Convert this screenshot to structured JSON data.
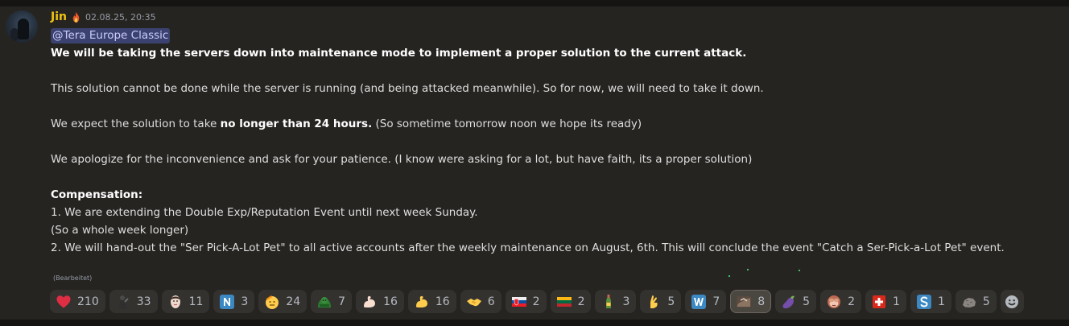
{
  "message": {
    "author": "Jin",
    "timestamp": "02.08.25, 20:35",
    "mention": "@Tera Europe Classic",
    "headline": "We will be taking the servers down into maintenance mode to implement a proper solution to the current attack.",
    "paragraph1": "This solution cannot be done while the server is running (and being attacked meanwhile). So for now, we will need to take it down.",
    "paragraph2": {
      "before": "We expect the solution to take ",
      "bold": "no longer than 24 hours.",
      "after": " (So sometime tomorrow noon we hope its ready)"
    },
    "paragraph3": "We apologize for the inconvenience and ask for your patience. (I know were asking for a lot, but have faith, its a proper solution)",
    "compensation_heading": "Compensation:",
    "compensation_lines": [
      "1. We are extending the Double Exp/Reputation Event until next week Sunday.",
      "(So a whole week longer)",
      "2. We will hand-out the \"Ser Pick-A-Lot Pet\" to all active accounts after the weekly maintenance on August, 6th. This will conclude the event \"Catch a Ser-Pick-a-Lot Pet\" event."
    ],
    "edited_label": "(Bearbeitet)"
  },
  "reactions": [
    {
      "icon": "heart-icon",
      "count": "210"
    },
    {
      "icon": "custom-figure-icon",
      "count": "33"
    },
    {
      "icon": "custom-face-icon",
      "count": "11"
    },
    {
      "icon": "letter-n-icon",
      "count": "3"
    },
    {
      "icon": "saluting-face-icon",
      "count": "24"
    },
    {
      "icon": "custom-green-emote-icon",
      "count": "7"
    },
    {
      "icon": "flexed-biceps-light-icon",
      "count": "16"
    },
    {
      "icon": "flexed-biceps-icon",
      "count": "16"
    },
    {
      "icon": "handshake-icon",
      "count": "6"
    },
    {
      "icon": "flag-slovakia-icon",
      "count": "2"
    },
    {
      "icon": "flag-lithuania-icon",
      "count": "2"
    },
    {
      "icon": "bottle-icon",
      "count": "3"
    },
    {
      "icon": "crossed-fingers-icon",
      "count": "5"
    },
    {
      "icon": "letter-w-icon",
      "count": "7"
    },
    {
      "icon": "custom-image-emote-icon",
      "count": "8"
    },
    {
      "icon": "eggplant-icon",
      "count": "5"
    },
    {
      "icon": "see-no-evil-monkey-icon",
      "count": "2"
    },
    {
      "icon": "swiss-flag-icon",
      "count": "1"
    },
    {
      "icon": "letter-s-icon",
      "count": "1"
    },
    {
      "icon": "rock-icon",
      "count": "5"
    }
  ],
  "colors": {
    "author": "#f1c40f",
    "mention_bg": "#3c4270",
    "reaction_bg": "#34322f",
    "message_bg": "#262421"
  }
}
